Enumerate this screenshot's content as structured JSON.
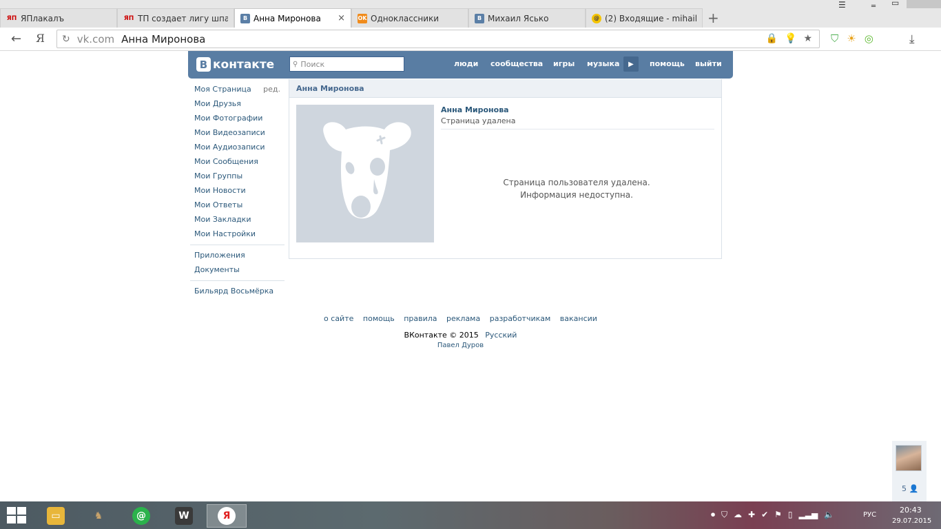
{
  "browser": {
    "tabs": [
      {
        "label": "ЯПлакалъ",
        "icon": "yaplakal-favicon",
        "active": false
      },
      {
        "label": "ТП создает лигу шпа...",
        "icon": "yaplakal-favicon",
        "active": false
      },
      {
        "label": "Анна Миронова",
        "icon": "vk-favicon",
        "active": true
      },
      {
        "label": "Одноклассники",
        "icon": "ok-favicon",
        "active": false
      },
      {
        "label": "Михаил Ясько",
        "icon": "vk-favicon",
        "active": false
      },
      {
        "label": "(2) Входящие - mihail...",
        "icon": "mail-favicon",
        "active": false
      }
    ],
    "tab_close_glyph": "×",
    "new_tab_glyph": "+",
    "yap_text": "ЯП",
    "vk_letter": "B",
    "url_domain": "vk.com",
    "url_title": "Анна Миронова",
    "yandex_letter": "Я"
  },
  "vk": {
    "logo_text": "контакте",
    "logo_letter": "B",
    "search_placeholder": "Поиск",
    "nav": {
      "people": "люди",
      "communities": "сообщества",
      "games": "игры",
      "music": "музыка",
      "help": "помощь",
      "logout": "выйти"
    },
    "accent": "#597da3",
    "link_color": "#2b587a"
  },
  "left_menu": {
    "edit_label": "ред.",
    "items": [
      "Моя Страница",
      "Мои Друзья",
      "Мои Фотографии",
      "Мои Видеозаписи",
      "Мои Аудиозаписи",
      "Мои Сообщения",
      "Мои Группы",
      "Мои Новости",
      "Мои Ответы",
      "Мои Закладки",
      "Мои Настройки"
    ],
    "extra_items": [
      "Приложения",
      "Документы"
    ],
    "apps": [
      "Бильярд Восьмёрка"
    ]
  },
  "profile": {
    "header": "Анна Миронова",
    "name": "Анна Миронова",
    "status": "Страница удалена",
    "deleted_line1": "Страница пользователя удалена.",
    "deleted_line2": "Информация недоступна."
  },
  "footer": {
    "links": [
      "о сайте",
      "помощь",
      "правила",
      "реклама",
      "разработчикам",
      "вакансии"
    ],
    "copyright": "ВКонтакте © 2015",
    "language": "Русский",
    "author": "Павел Дуров"
  },
  "friends_widget": {
    "count": "5"
  },
  "taskbar": {
    "language": "РУС",
    "time": "20:43",
    "date": "29.07.2015"
  }
}
